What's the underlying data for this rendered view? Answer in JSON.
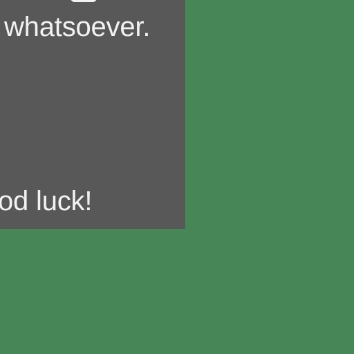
{
  "window": {
    "background": "#478656"
  },
  "dialog": {
    "background": "#585858",
    "text_color": "#f2f2f2",
    "line_1": "whatsoever.",
    "line_2": "od luck!"
  }
}
